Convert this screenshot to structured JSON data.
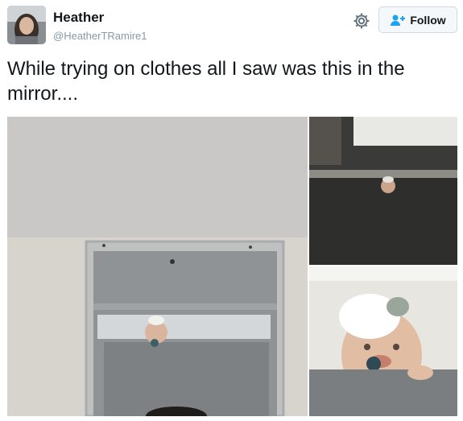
{
  "user": {
    "display_name": "Heather",
    "handle": "@HeatherTRamire1",
    "avatar": "user-avatar-photo"
  },
  "actions": {
    "settings_icon": "gear-icon",
    "follow_label": "Follow",
    "follow_icon": "add-user-icon",
    "follow_color": "#1da1f2"
  },
  "tweet": {
    "text": "While trying on clothes all I saw was this in the mirror...."
  },
  "media": [
    {
      "position": "left",
      "depicts": "mirror-with-baby-peeking"
    },
    {
      "position": "top-right",
      "depicts": "baby-peeking-over-stall"
    },
    {
      "position": "bottom-right",
      "depicts": "baby-closeup-with-bow"
    }
  ]
}
